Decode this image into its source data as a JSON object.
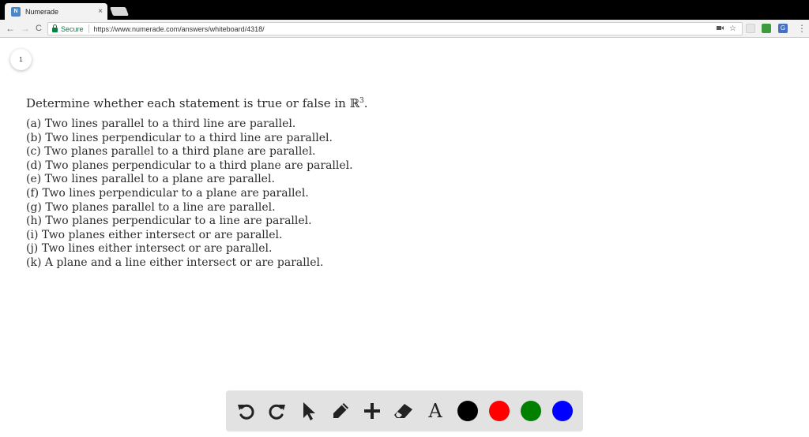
{
  "browser": {
    "tab_title": "Numerade",
    "favicon_text": "N",
    "tab_close": "×",
    "secure_label": "Secure",
    "url": "https://www.numerade.com/answers/whiteboard/4318/",
    "nav": {
      "back": "←",
      "forward": "→",
      "reload": "C"
    },
    "menu": "⋮",
    "bookmark_star": "☆",
    "extensions": {
      "green_label": "",
      "blue_label": "G"
    }
  },
  "whiteboard": {
    "page_number": "1",
    "prompt_text": "Determine whether each statement is true or false in ",
    "prompt_symbol": "ℝ",
    "prompt_exponent": "3",
    "prompt_end": ".",
    "items": [
      "(a) Two lines parallel to a third line are parallel.",
      "(b) Two lines perpendicular to a third line are parallel.",
      "(c) Two planes parallel to a third plane are parallel.",
      "(d) Two planes perpendicular to a third plane are parallel.",
      "(e) Two lines parallel to a plane are parallel.",
      "(f) Two lines perpendicular to a plane are parallel.",
      "(g) Two planes parallel to a line are parallel.",
      "(h) Two planes perpendicular to a line are parallel.",
      "(i) Two planes either intersect or are parallel.",
      "(j) Two lines either intersect or are parallel.",
      "(k) A plane and a line either intersect or are parallel."
    ]
  },
  "draw_toolbar": {
    "tools": [
      "undo-icon",
      "redo-icon",
      "pointer-icon",
      "pencil-icon",
      "plus-icon",
      "eraser-icon",
      "text-icon"
    ],
    "text_tool_label": "A",
    "colors": [
      "#000000",
      "#ff0000",
      "#008000",
      "#0000ff"
    ]
  }
}
